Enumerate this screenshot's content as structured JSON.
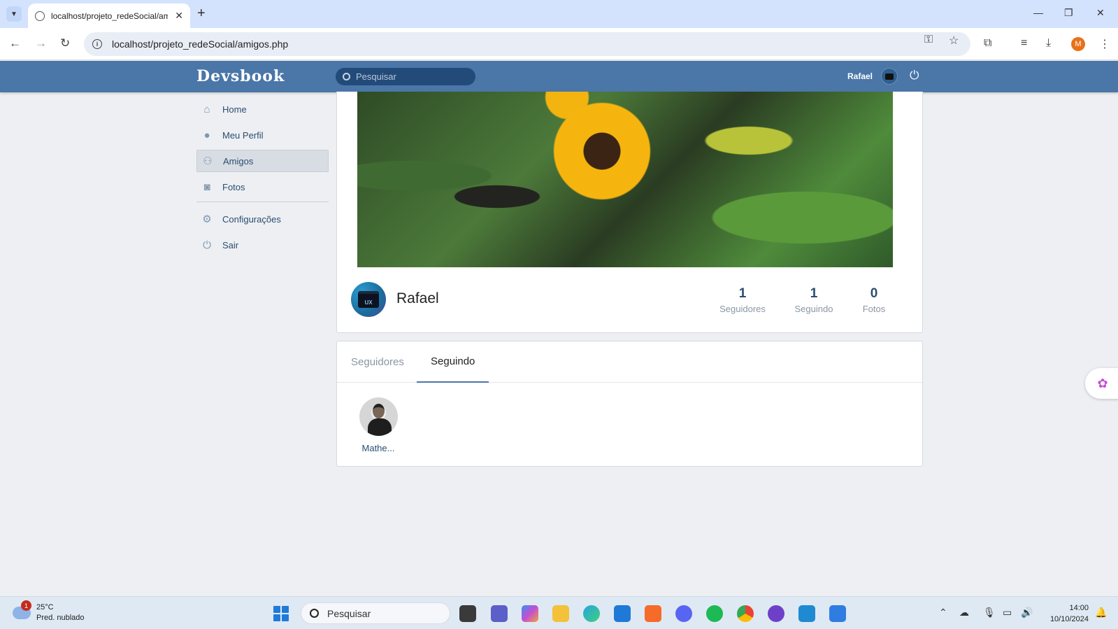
{
  "browser": {
    "tab_title": "localhost/projeto_redeSocial/am",
    "url": "localhost/projeto_redeSocial/amigos.php",
    "profile_initial": "M"
  },
  "header": {
    "logo": "Devsbook",
    "search_placeholder": "Pesquisar",
    "user_name": "Rafael"
  },
  "sidebar": {
    "items": [
      {
        "label": "Home",
        "icon": "home-icon"
      },
      {
        "label": "Meu Perfil",
        "icon": "user-icon"
      },
      {
        "label": "Amigos",
        "icon": "friends-icon",
        "active": true
      },
      {
        "label": "Fotos",
        "icon": "camera-icon"
      },
      {
        "label": "Configurações",
        "icon": "gear-icon"
      },
      {
        "label": "Sair",
        "icon": "power-icon"
      }
    ]
  },
  "profile": {
    "name": "Rafael",
    "avatar_text": "UX",
    "stats": [
      {
        "num": "1",
        "label": "Seguidores"
      },
      {
        "num": "1",
        "label": "Seguindo"
      },
      {
        "num": "0",
        "label": "Fotos"
      }
    ]
  },
  "friends": {
    "tabs": [
      "Seguidores",
      "Seguindo"
    ],
    "active_tab": "Seguindo",
    "list": [
      {
        "name": "Mathe..."
      }
    ]
  },
  "taskbar": {
    "weather_temp": "25°C",
    "weather_desc": "Pred. nublado",
    "weather_badge": "1",
    "search": "Pesquisar",
    "time": "14:00",
    "date": "10/10/2024"
  },
  "colors": {
    "brand": "#4a76a8",
    "link": "#2b4d72"
  }
}
